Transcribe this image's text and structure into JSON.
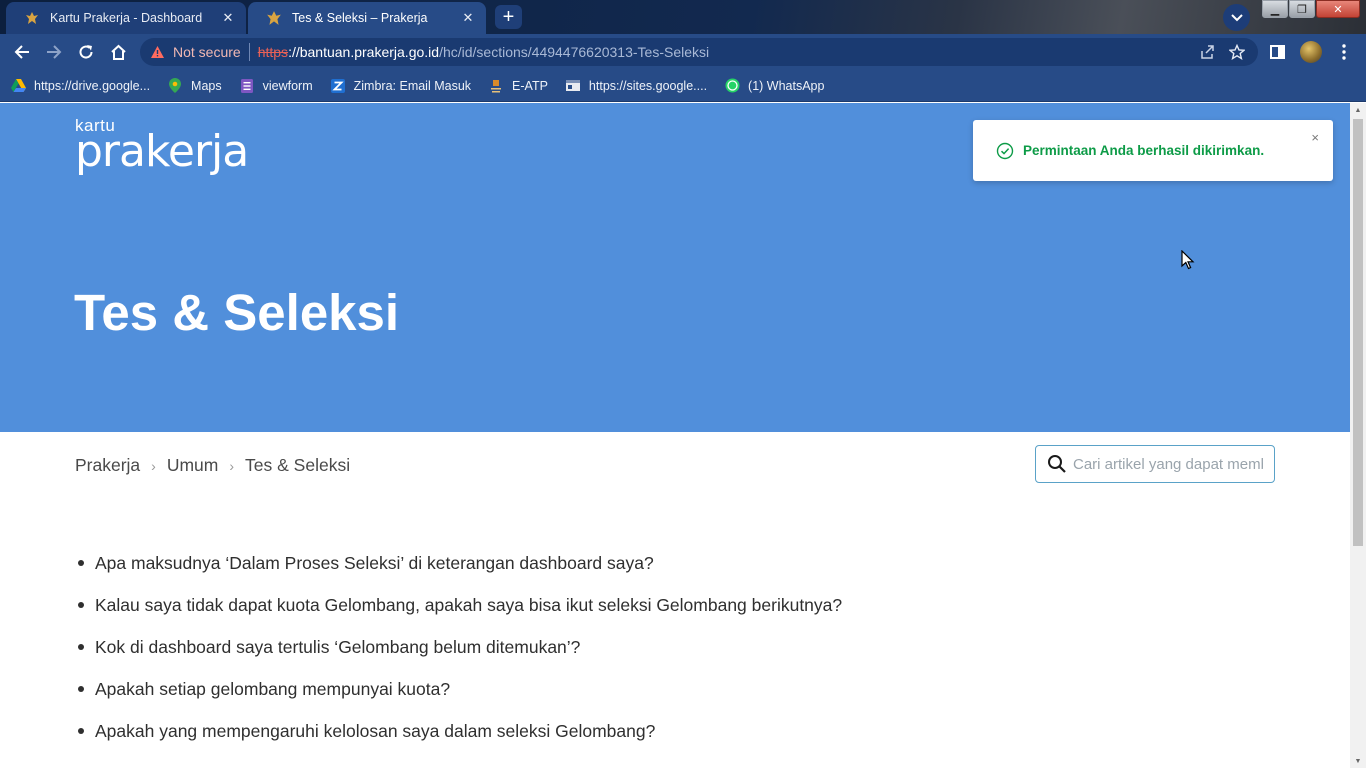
{
  "browser": {
    "tabs": [
      {
        "title": "Kartu Prakerja - Dashboard",
        "active": false
      },
      {
        "title": "Tes & Seleksi – Prakerja",
        "active": true
      }
    ],
    "address": {
      "security_label": "Not secure",
      "url_scheme": "https",
      "url_host": "://bantuan.prakerja.go.id",
      "url_path": "/hc/id/sections/4494476620313-Tes-Seleksi"
    },
    "bookmarks": [
      {
        "label": "https://drive.google...",
        "icon": "google-drive-icon"
      },
      {
        "label": "Maps",
        "icon": "maps-pin-icon"
      },
      {
        "label": "viewform",
        "icon": "forms-icon"
      },
      {
        "label": "Zimbra: Email Masuk",
        "icon": "zimbra-icon"
      },
      {
        "label": "E-ATP",
        "icon": "eatp-icon"
      },
      {
        "label": "https://sites.google....",
        "icon": "sites-icon"
      },
      {
        "label": "(1) WhatsApp",
        "icon": "whatsapp-icon"
      }
    ]
  },
  "page": {
    "logo": {
      "small": "kartu",
      "big": "prakerja"
    },
    "title": "Tes & Seleksi",
    "toast": {
      "message": "Permintaan Anda berhasil dikirimkan.",
      "close": "×"
    },
    "breadcrumb": [
      "Prakerja",
      "Umum",
      "Tes & Seleksi"
    ],
    "search": {
      "placeholder": "Cari artikel yang dapat membantu"
    },
    "articles": [
      "Apa maksudnya ‘Dalam Proses Seleksi’ di keterangan dashboard saya?",
      "Kalau saya tidak dapat kuota Gelombang, apakah saya bisa ikut seleksi Gelombang berikutnya?",
      "Kok di dashboard saya tertulis ‘Gelombang belum ditemukan’?",
      "Apakah setiap gelombang mempunyai kuota?",
      "Apakah yang mempengaruhi kelolosan saya dalam seleksi Gelombang?"
    ]
  },
  "colors": {
    "hero": "#518fdb",
    "chrome": "#274b87",
    "toast_text": "#0d9b47"
  }
}
